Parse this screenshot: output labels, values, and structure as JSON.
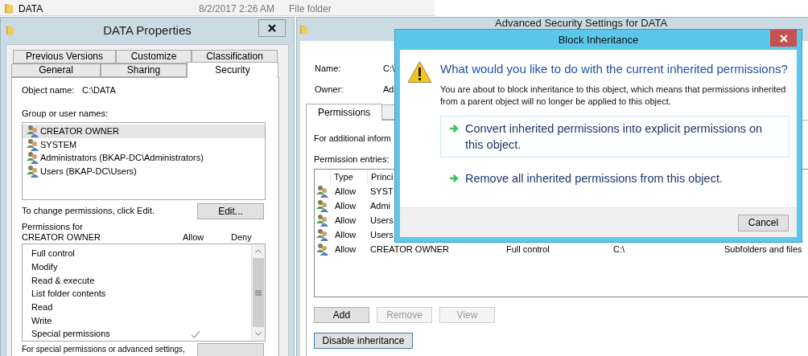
{
  "explorer_row": {
    "name": "DATA",
    "date": "8/2/2017 2:26 AM",
    "type": "File folder"
  },
  "properties": {
    "title": "DATA Properties",
    "tab_rows": [
      [
        {
          "label": "Previous Versions",
          "selected": false
        },
        {
          "label": "Customize",
          "selected": false
        },
        {
          "label": "Classification",
          "selected": false
        }
      ],
      [
        {
          "label": "General",
          "selected": false
        },
        {
          "label": "Sharing",
          "selected": false
        },
        {
          "label": "Security",
          "selected": true
        }
      ]
    ],
    "object_label": "Object name:",
    "object_value": "C:\\DATA",
    "groups_label": "Group or user names:",
    "groups": [
      {
        "label": "CREATOR OWNER",
        "selected": true
      },
      {
        "label": "SYSTEM",
        "selected": false
      },
      {
        "label": "Administrators (BKAP-DC\\Administrators)",
        "selected": false
      },
      {
        "label": "Users (BKAP-DC\\Users)",
        "selected": false
      }
    ],
    "change_hint": "To change permissions, click Edit.",
    "edit_button": "Edit...",
    "permissions_label": "Permissions for CREATOR OWNER",
    "allow_header": "Allow",
    "deny_header": "Deny",
    "permissions": [
      {
        "label": "Full control",
        "allow": false,
        "deny": false
      },
      {
        "label": "Modify",
        "allow": false,
        "deny": false
      },
      {
        "label": "Read & execute",
        "allow": false,
        "deny": false
      },
      {
        "label": "List folder contents",
        "allow": false,
        "deny": false
      },
      {
        "label": "Read",
        "allow": false,
        "deny": false
      },
      {
        "label": "Write",
        "allow": false,
        "deny": false
      },
      {
        "label": "Special permissions",
        "allow": true,
        "deny": false
      }
    ],
    "special_hint": "For special permissions or advanced settings,"
  },
  "advanced": {
    "title": "Advanced Security Settings for DATA",
    "name_label": "Name:",
    "name_value": "C:\\",
    "owner_label": "Owner:",
    "owner_value": "Ad",
    "tabs": [
      {
        "label": "Permissions",
        "selected": true
      }
    ],
    "info_text": "For additional inform",
    "entries_label": "Permission entries:",
    "columns": [
      "Type",
      "Princi"
    ],
    "rows": [
      {
        "type": "Allow",
        "principal": "SYST"
      },
      {
        "type": "Allow",
        "principal": "Admi"
      },
      {
        "type": "Allow",
        "principal": "Users"
      },
      {
        "type": "Allow",
        "principal": "Users"
      },
      {
        "type": "Allow",
        "principal": "CREATOR OWNER",
        "access": "Full control",
        "inherited_from": "C:\\",
        "applies_to": "Subfolders and files"
      }
    ],
    "buttons": [
      {
        "label": "Add",
        "disabled": false
      },
      {
        "label": "Remove",
        "disabled": true
      },
      {
        "label": "View",
        "disabled": true
      }
    ],
    "inheritance_button": "Disable inheritance"
  },
  "dialog": {
    "title": "Block Inheritance",
    "heading": "What would you like to do with the current inherited permissions?",
    "description": "You are about to block inheritance to this object, which means that permissions inherited from a parent object will no longer be applied to this object.",
    "options": [
      {
        "label": "Convert inherited permissions into explicit permissions on this object.",
        "selected": true
      },
      {
        "label": "Remove all inherited permissions from this object.",
        "selected": false
      }
    ],
    "cancel_button": "Cancel"
  }
}
